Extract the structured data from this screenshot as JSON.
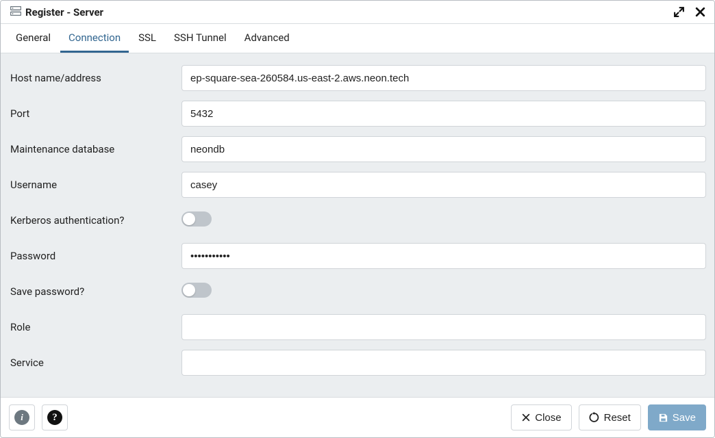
{
  "dialog": {
    "title": "Register - Server"
  },
  "tabs": {
    "general": "General",
    "connection": "Connection",
    "ssl": "SSL",
    "ssh_tunnel": "SSH Tunnel",
    "advanced": "Advanced"
  },
  "labels": {
    "host": "Host name/address",
    "port": "Port",
    "maint_db": "Maintenance database",
    "username": "Username",
    "kerberos": "Kerberos authentication?",
    "password": "Password",
    "save_password": "Save password?",
    "role": "Role",
    "service": "Service"
  },
  "values": {
    "host": "ep-square-sea-260584.us-east-2.aws.neon.tech",
    "port": "5432",
    "maint_db": "neondb",
    "username": "casey",
    "password": "•••••••••••",
    "role": "",
    "service": ""
  },
  "buttons": {
    "close": "Close",
    "reset": "Reset",
    "save": "Save"
  }
}
